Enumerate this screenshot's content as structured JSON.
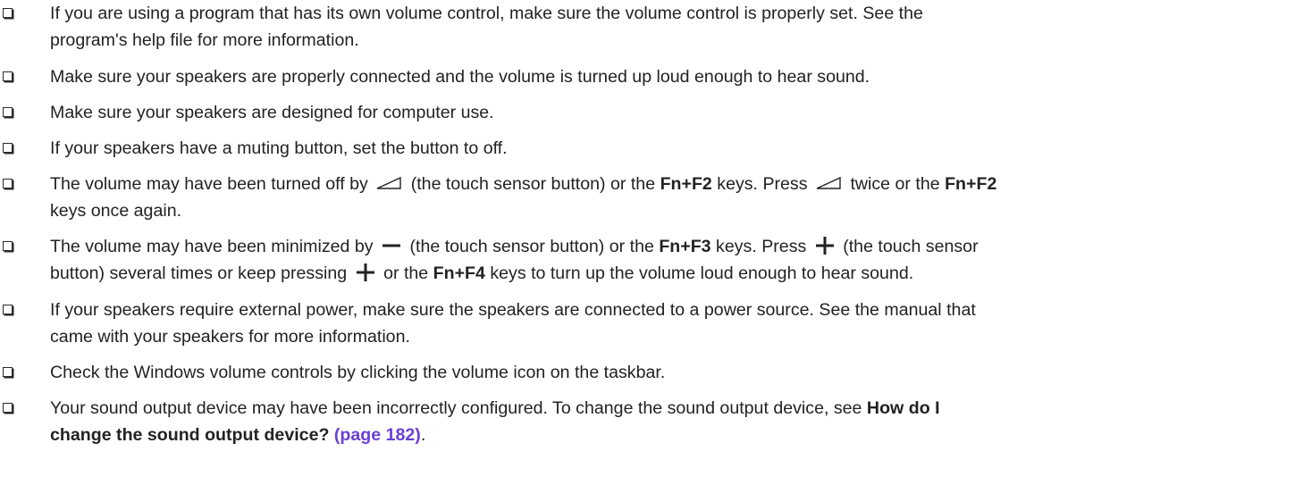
{
  "items": [
    {
      "line1": "If you are using a program that has its own volume control, make sure the volume control is properly set. See the",
      "line2": "program's help file for more information."
    },
    {
      "line1": "Make sure your speakers are properly connected and the volume is turned up loud enough to hear sound."
    },
    {
      "line1": "Make sure your speakers are designed for computer use."
    },
    {
      "line1": "If your speakers have a muting button, set the button to off."
    },
    {
      "p1": "The volume may have been turned off by",
      "p2": "(the touch sensor button) or the",
      "key1": "Fn+F2",
      "p3": "keys. Press",
      "p4": "twice or the",
      "key2": "Fn+F2",
      "line2": "keys once again."
    },
    {
      "p1": "The volume may have been minimized by",
      "p2": "(the touch sensor button) or the",
      "key1": "Fn+F3",
      "p3": "keys. Press",
      "p4": "(the touch sensor",
      "l2a": "button) several times or keep pressing",
      "l2b": "or the",
      "key2": "Fn+F4",
      "l2c": "keys to turn up the volume loud enough to hear sound."
    },
    {
      "line1": "If your speakers require external power, make sure the speakers are connected to a power source. See the manual that",
      "line2": "came with your speakers for more information."
    },
    {
      "line1": "Check the Windows volume controls by clicking the volume icon on the taskbar."
    },
    {
      "line1a": "Your sound output device may have been incorrectly configured. To change the sound output device, see",
      "link_bold_1": "How do I",
      "link_bold_2": "change the sound output device?",
      "page_ref": "(page 182)",
      "end": "."
    }
  ],
  "icons": {
    "volume": "volume-ramp-icon",
    "minus": "minus-icon",
    "plus": "plus-icon"
  },
  "colors": {
    "text": "#222222",
    "link": "#6a3fd6"
  }
}
